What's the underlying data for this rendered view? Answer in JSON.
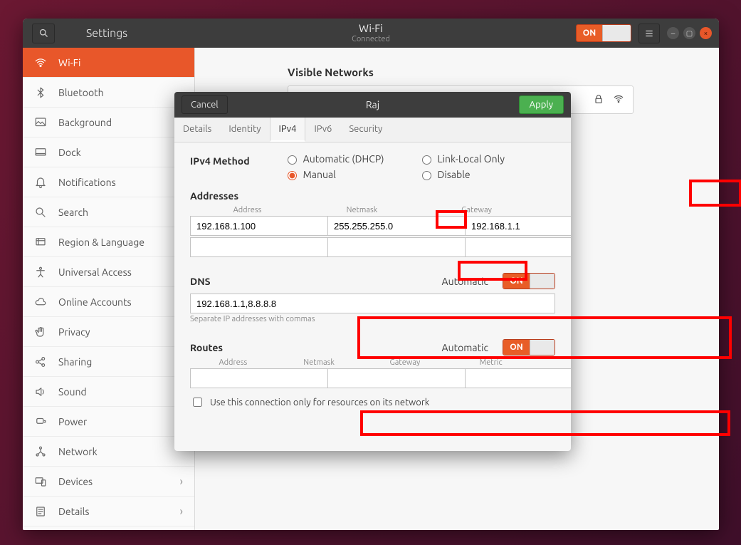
{
  "titlebar": {
    "title": "Settings",
    "center_title": "Wi-Fi",
    "center_sub": "Connected",
    "wifi_switch_label": "ON"
  },
  "sidebar": {
    "items": [
      {
        "label": "Wi-Fi",
        "icon": "wifi",
        "active": true
      },
      {
        "label": "Bluetooth",
        "icon": "bluetooth",
        "active": false
      },
      {
        "label": "Background",
        "icon": "background",
        "active": false
      },
      {
        "label": "Dock",
        "icon": "dock",
        "active": false
      },
      {
        "label": "Notifications",
        "icon": "bell",
        "active": false
      },
      {
        "label": "Search",
        "icon": "search",
        "active": false
      },
      {
        "label": "Region & Language",
        "icon": "globe",
        "active": false
      },
      {
        "label": "Universal Access",
        "icon": "access",
        "active": false
      },
      {
        "label": "Online Accounts",
        "icon": "cloud",
        "active": false
      },
      {
        "label": "Privacy",
        "icon": "hand",
        "active": false
      },
      {
        "label": "Sharing",
        "icon": "share",
        "active": false
      },
      {
        "label": "Sound",
        "icon": "sound",
        "active": false
      },
      {
        "label": "Power",
        "icon": "power",
        "active": false
      },
      {
        "label": "Network",
        "icon": "network",
        "active": false
      },
      {
        "label": "Devices",
        "icon": "devices",
        "active": false,
        "chevron": true
      },
      {
        "label": "Details",
        "icon": "details",
        "active": false,
        "chevron": true
      }
    ]
  },
  "content": {
    "visible_networks_label": "Visible Networks"
  },
  "dialog": {
    "cancel": "Cancel",
    "title": "Raj",
    "apply": "Apply",
    "tabs": [
      "Details",
      "Identity",
      "IPv4",
      "IPv6",
      "Security"
    ],
    "active_tab": 2,
    "method_label": "IPv4 Method",
    "methods": {
      "auto": "Automatic (DHCP)",
      "manual": "Manual",
      "linklocal": "Link-Local Only",
      "disable": "Disable"
    },
    "selected_method": "manual",
    "addresses_label": "Addresses",
    "address_cols": [
      "Address",
      "Netmask",
      "Gateway"
    ],
    "addresses": [
      {
        "address": "192.168.1.100",
        "netmask": "255.255.255.0",
        "gateway": "192.168.1.1"
      },
      {
        "address": "",
        "netmask": "",
        "gateway": ""
      }
    ],
    "dns_label": "DNS",
    "automatic_label": "Automatic",
    "dns_switch": "ON",
    "dns_value": "192.168.1.1,8.8.8.8",
    "dns_hint": "Separate IP addresses with commas",
    "routes_label": "Routes",
    "routes_switch": "ON",
    "route_cols": [
      "Address",
      "Netmask",
      "Gateway",
      "Metric"
    ],
    "routes": [
      {
        "address": "",
        "netmask": "",
        "gateway": "",
        "metric": ""
      }
    ],
    "routes_only_label": "Use this connection only for resources on its network"
  }
}
